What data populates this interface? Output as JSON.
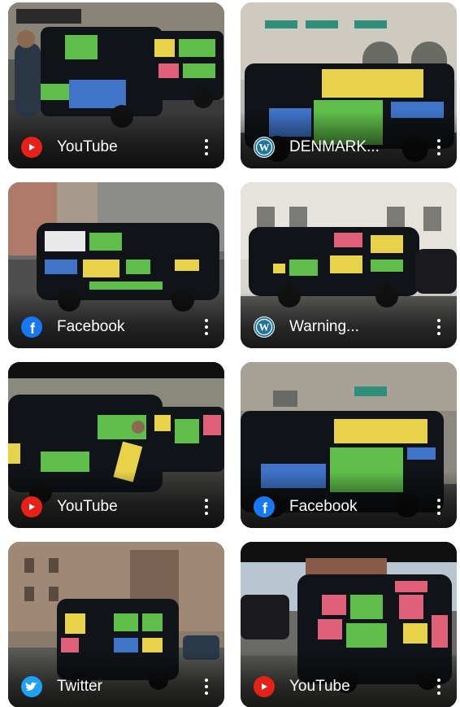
{
  "cards": [
    {
      "source": "YouTube",
      "icon": "youtube-icon"
    },
    {
      "source": "DENMARK...",
      "icon": "wordpress-icon"
    },
    {
      "source": "Facebook",
      "icon": "facebook-icon"
    },
    {
      "source": "Warning...",
      "icon": "wordpress-icon"
    },
    {
      "source": "YouTube",
      "icon": "youtube-icon"
    },
    {
      "source": "Facebook",
      "icon": "facebook-icon"
    },
    {
      "source": "Twitter",
      "icon": "twitter-icon"
    },
    {
      "source": "YouTube",
      "icon": "youtube-icon"
    }
  ],
  "colors": {
    "youtube": "#e62117",
    "wordpress": "#21759b",
    "facebook": "#1877f2",
    "twitter": "#1da1f2",
    "van": "#101418",
    "poster_yellow": "#e8d24a",
    "poster_green": "#5fbf4a",
    "poster_blue": "#3f74c9",
    "poster_pink": "#e0607a"
  }
}
